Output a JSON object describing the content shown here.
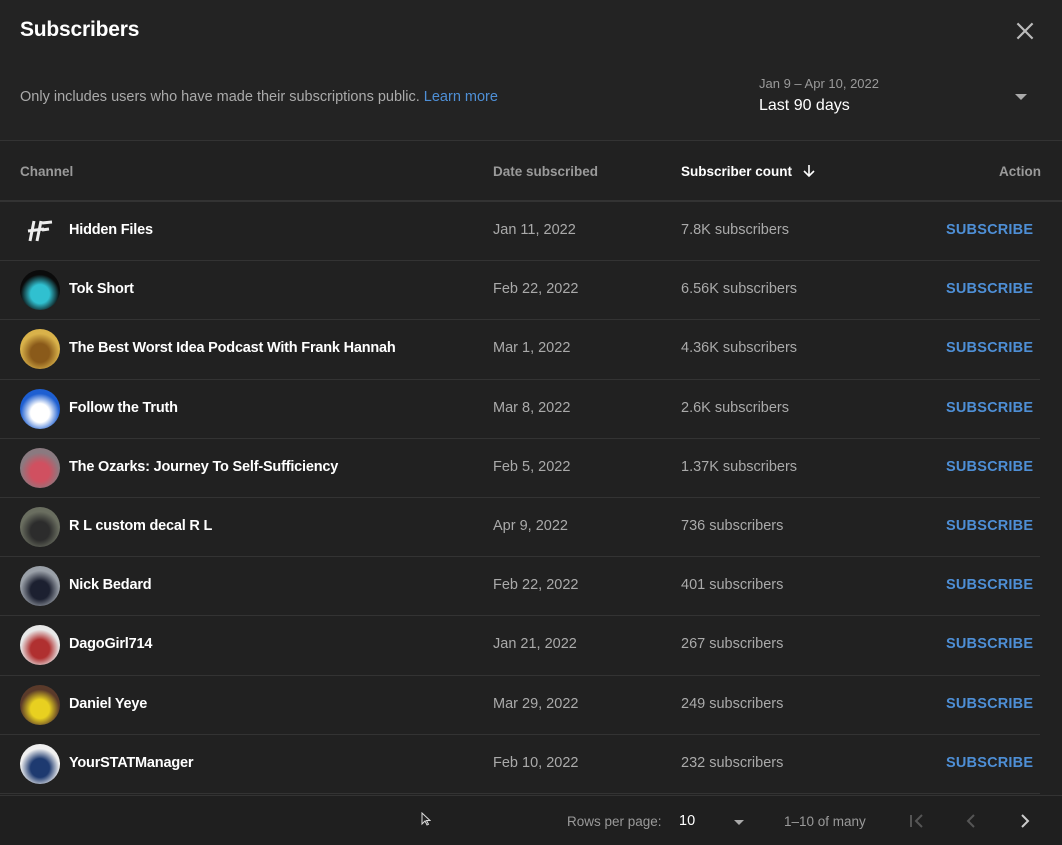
{
  "dialog": {
    "title": "Subscribers",
    "close_icon": "close-icon",
    "subtitle": "Only includes users who have made their subscriptions public.",
    "learn_more": "Learn more"
  },
  "date_range": {
    "dates": "Jan 9 – Apr 10, 2022",
    "label": "Last 90 days"
  },
  "table": {
    "columns": {
      "channel": "Channel",
      "date": "Date subscribed",
      "count": "Subscriber count",
      "action": "Action"
    },
    "sort_icon": "arrow-down-icon",
    "rows": [
      {
        "name": "Hidden Files",
        "date": "Jan 11, 2022",
        "count": "7.8K subscribers",
        "action": "SUBSCRIBE",
        "avatar_colors": [
          "#1a1a1a",
          "#e8e8e8"
        ]
      },
      {
        "name": "Tok Short",
        "date": "Feb 22, 2022",
        "count": "6.56K subscribers",
        "action": "SUBSCRIBE",
        "avatar_colors": [
          "#0b0b0b",
          "#30c0d0"
        ]
      },
      {
        "name": "The Best Worst Idea Podcast With Frank Hannah",
        "date": "Mar 1, 2022",
        "count": "4.36K subscribers",
        "action": "SUBSCRIBE",
        "avatar_colors": [
          "#d9b24a",
          "#8a5a1a"
        ]
      },
      {
        "name": "Follow the Truth",
        "date": "Mar 8, 2022",
        "count": "2.6K subscribers",
        "action": "SUBSCRIBE",
        "avatar_colors": [
          "#1e5fd1",
          "#ffffff"
        ]
      },
      {
        "name": "The Ozarks: Journey To Self-Sufficiency",
        "date": "Feb 5, 2022",
        "count": "1.37K subscribers",
        "action": "SUBSCRIBE",
        "avatar_colors": [
          "#8a7a80",
          "#d05060"
        ]
      },
      {
        "name": "R L custom decal R L",
        "date": "Apr 9, 2022",
        "count": "736 subscribers",
        "action": "SUBSCRIBE",
        "avatar_colors": [
          "#6a6e60",
          "#2c2c2c"
        ]
      },
      {
        "name": "Nick Bedard",
        "date": "Feb 22, 2022",
        "count": "401 subscribers",
        "action": "SUBSCRIBE",
        "avatar_colors": [
          "#9aa0a8",
          "#1c2030"
        ]
      },
      {
        "name": "DagoGirl714",
        "date": "Jan 21, 2022",
        "count": "267 subscribers",
        "action": "SUBSCRIBE",
        "avatar_colors": [
          "#e8e8e8",
          "#b03030"
        ]
      },
      {
        "name": "Daniel Yeye",
        "date": "Mar 29, 2022",
        "count": "249 subscribers",
        "action": "SUBSCRIBE",
        "avatar_colors": [
          "#5a3a2a",
          "#e8d020"
        ]
      },
      {
        "name": "YourSTATManager",
        "date": "Feb 10, 2022",
        "count": "232 subscribers",
        "action": "SUBSCRIBE",
        "avatar_colors": [
          "#f0f0f0",
          "#1e3a70"
        ]
      }
    ]
  },
  "pagination": {
    "rows_label": "Rows per page:",
    "rows_value": "10",
    "range": "1–10 of many",
    "first_icon": "first-page-icon",
    "prev_icon": "chevron-left-icon",
    "next_icon": "chevron-right-icon"
  },
  "colors": {
    "background": "#212121",
    "link": "#4e8fd6",
    "muted_text": "#aaaaaa"
  }
}
